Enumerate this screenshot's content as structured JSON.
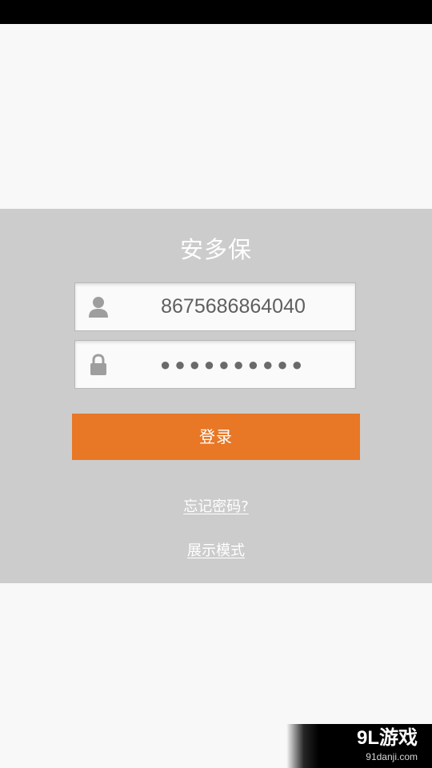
{
  "app": {
    "title": "安多保"
  },
  "login": {
    "username_value": "8675686864040",
    "password_masked": "●●●●●●●●●●",
    "submit_label": "登录",
    "forgot_password_label": "忘记密码?",
    "demo_mode_label": "展示模式"
  },
  "icons": {
    "user": "user-icon",
    "lock": "lock-icon"
  },
  "colors": {
    "panel_bg": "#cccccc",
    "page_bg": "#f8f8f8",
    "button_bg": "#e87726",
    "text_light": "#ffffff"
  },
  "watermark": {
    "brand": "9L游戏",
    "domain": "91danji.com"
  }
}
